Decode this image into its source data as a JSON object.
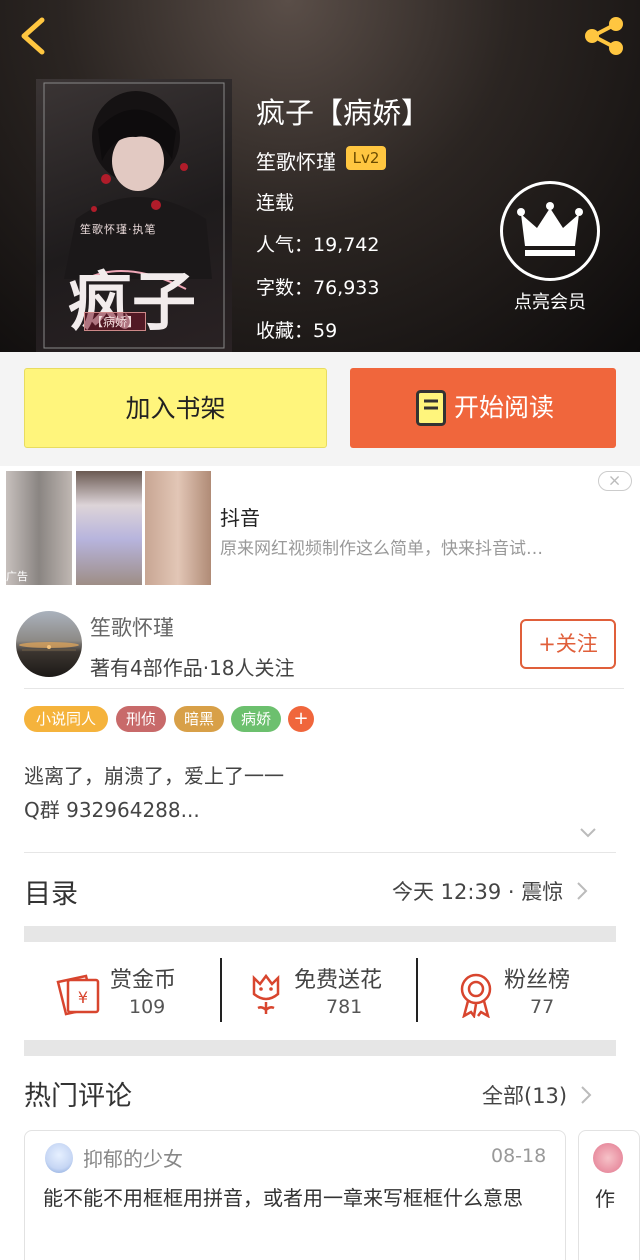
{
  "header": {
    "back_icon": "back-arrow-icon",
    "share_icon": "share-icon",
    "accent": "#ffc640"
  },
  "cover": {
    "credit": "笙歌怀瑾·执笔",
    "big_text": "疯子",
    "sub_text": "【病娇】"
  },
  "book": {
    "title": "疯子【病娇】",
    "author": "笙歌怀瑾",
    "level": "Lv2",
    "status": "连载",
    "popularity": "人气：19,742",
    "word_count": "字数：76,933",
    "favorites": "收藏：59"
  },
  "vip": {
    "icon": "crown-icon",
    "label": "点亮会员"
  },
  "actions": {
    "shelf_label": "加入书架",
    "read_label": "开始阅读",
    "shelf_color": "#fff57c",
    "read_color": "#f0663c"
  },
  "ad": {
    "tag": "广告",
    "title": "抖音",
    "desc": "原来网红视频制作这么简单，快来抖音试…"
  },
  "author_section": {
    "name": "笙歌怀瑾",
    "stats": "著有4部作品·18人关注",
    "follow_label": "+关注"
  },
  "tags": [
    {
      "label": "小说同人",
      "color": "#f5b33c"
    },
    {
      "label": "刑侦",
      "color": "#c86a6a"
    },
    {
      "label": "暗黑",
      "color": "#d8a048"
    },
    {
      "label": "病娇",
      "color": "#6cc06e"
    },
    {
      "label": "+",
      "color": "#f0663c"
    }
  ],
  "description": {
    "line1": "逃离了，崩溃了，爱上了一一",
    "line2": "Q群  932964288..."
  },
  "toc": {
    "label": "目录",
    "latest": "今天 12:39 · 震惊"
  },
  "stats": [
    {
      "label": "赏金币",
      "value": "109",
      "icon": "red-envelope-icon"
    },
    {
      "label": "免费送花",
      "value": "781",
      "icon": "flower-icon"
    },
    {
      "label": "粉丝榜",
      "value": "77",
      "icon": "medal-icon"
    }
  ],
  "comments": {
    "label": "热门评论",
    "all_label": "全部(13)",
    "items": [
      {
        "user": "抑郁的少女",
        "date": "08-18",
        "text": "能不能不用框框用拼音，或者用一章来写框框什么意思"
      }
    ],
    "peek_text": "作"
  }
}
